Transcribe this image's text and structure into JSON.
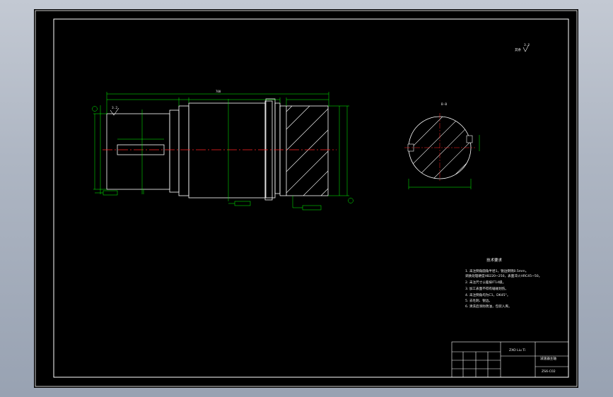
{
  "drawing": {
    "overall_length": "700",
    "section_label": "B-B",
    "surface_finish": "3.2",
    "datum_label": "B",
    "corner_roughness": "其余",
    "notes_title": "技术要求",
    "notes": [
      "1. 未注倒角圆角半径1，锐边倒钝0.5mm。",
      "   调质处理硬度HB220~250，表面淬火HRC45~50。",
      "2. 未注尺寸公差按IT14级。",
      "3. 加工表面不得有磕碰划伤。",
      "4. 未注倒角均为C1，DK45°。",
      "5. 去毛刺、锐边。",
      "6. 清洗后涂防锈油，包装入库。"
    ],
    "title_block": {
      "designer": "ZXO Liu Ti",
      "part_name": "减速器主轴",
      "drawing_no": "ZS6-C02"
    }
  },
  "colors": {
    "sheet": "#000000",
    "outline": "#ffffff",
    "dimension": "#00ff00",
    "centerline": "#ff2020",
    "hatch": "#ffffff"
  }
}
